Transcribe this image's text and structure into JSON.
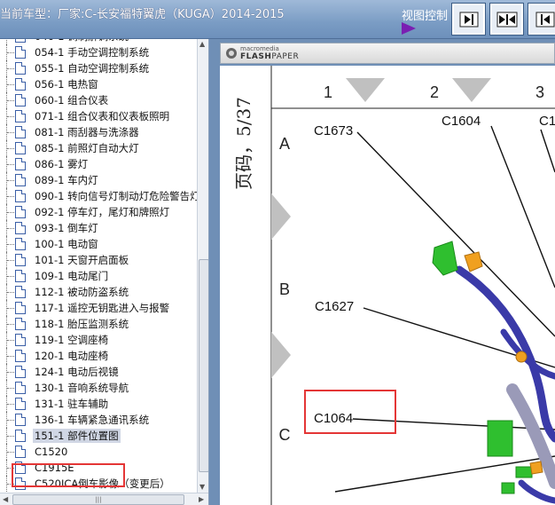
{
  "header": {
    "vehicle_title": "当前车型：厂家:C-长安福特翼虎（KUGA）2014-2015",
    "view_control_label": "视图控制"
  },
  "toolbar": {
    "buttons": [
      {
        "icon": "collapse-left-icon"
      },
      {
        "icon": "center-split-icon"
      },
      {
        "icon": "expand-right-icon"
      }
    ]
  },
  "tree": {
    "items": [
      {
        "label": "046-1 调制解调系统"
      },
      {
        "label": "054-1 手动空调控制系统"
      },
      {
        "label": "055-1 自动空调控制系统"
      },
      {
        "label": "056-1 电热窗"
      },
      {
        "label": "060-1 组合仪表"
      },
      {
        "label": "071-1 组合仪表和仪表板照明"
      },
      {
        "label": "081-1 雨刮器与洗涤器"
      },
      {
        "label": "085-1 前照灯自动大灯"
      },
      {
        "label": "086-1 雾灯"
      },
      {
        "label": "089-1 车内灯"
      },
      {
        "label": "090-1 转向信号灯制动灯危险警告灯"
      },
      {
        "label": "092-1 停车灯，尾灯和牌照灯"
      },
      {
        "label": "093-1 倒车灯"
      },
      {
        "label": "100-1 电动窗"
      },
      {
        "label": "101-1 天窗开启面板"
      },
      {
        "label": "109-1 电动尾门"
      },
      {
        "label": "112-1 被动防盗系统"
      },
      {
        "label": "117-1 遥控无钥匙进入与报警"
      },
      {
        "label": "118-1 胎压监测系统"
      },
      {
        "label": "119-1 空调座椅"
      },
      {
        "label": "120-1 电动座椅"
      },
      {
        "label": "124-1 电动后视镜"
      },
      {
        "label": "130-1 音响系统导航"
      },
      {
        "label": "131-1 驻车辅助"
      },
      {
        "label": "136-1 车辆紧急通讯系统"
      },
      {
        "label": "151-1 部件位置图",
        "selected": true
      },
      {
        "label": "C1520"
      },
      {
        "label": "C1915E"
      },
      {
        "label": "C520ICA倒车影像（变更后）"
      }
    ]
  },
  "viewer": {
    "brand_small": "macromedia",
    "brand_big": "FLASH",
    "brand_big_suffix": "PAPER",
    "page_indicator": "页码，5/37",
    "columns": [
      "1",
      "2",
      "3"
    ],
    "rows": [
      "A",
      "B",
      "C"
    ],
    "connectors": [
      "C1673",
      "C1604",
      "C16",
      "C1627",
      "C1064"
    ]
  },
  "colors": {
    "highlight": "#e43636",
    "harness_blue": "#3a3aa8",
    "component_green": "#2fbf2f",
    "connector_orange": "#f0a020"
  }
}
